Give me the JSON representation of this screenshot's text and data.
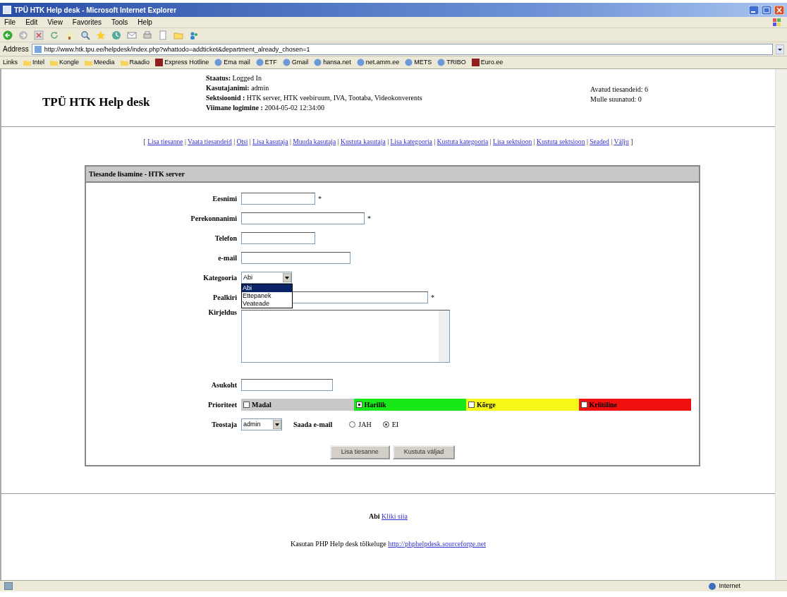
{
  "window": {
    "title": "TPÜ HTK Help desk - Microsoft Internet Explorer",
    "menu": [
      "File",
      "Edit",
      "View",
      "Favorites",
      "Tools",
      "Help"
    ],
    "address_label": "Address",
    "address": "http://www.htk.tpu.ee/helpdesk/index.php?whattodo=addticket&department_already_chosen=1",
    "links_label": "Links",
    "links": [
      {
        "label": "Intel",
        "kind": "folder"
      },
      {
        "label": "Kongle",
        "kind": "folder"
      },
      {
        "label": "Meedia",
        "kind": "folder"
      },
      {
        "label": "Raadio",
        "kind": "folder"
      },
      {
        "label": "Express Hotline",
        "kind": "site"
      },
      {
        "label": "Ema mail",
        "kind": "page"
      },
      {
        "label": "ETF",
        "kind": "page"
      },
      {
        "label": "Gmail",
        "kind": "page"
      },
      {
        "label": "hansa.net",
        "kind": "page"
      },
      {
        "label": "net.amm.ee",
        "kind": "page"
      },
      {
        "label": "METS",
        "kind": "page"
      },
      {
        "label": "TRIBO",
        "kind": "page"
      },
      {
        "label": "Euro.ee",
        "kind": "site"
      }
    ]
  },
  "header": {
    "logo": "TPÜ HTK Help desk",
    "status_lines": [
      {
        "label": "Staatus:",
        "value": "Logged In"
      },
      {
        "label": "Kasutajanimi:",
        "value": "admin"
      },
      {
        "label": "Sektsioonid :",
        "value": "HTK server, HTK veebiruum, IVA, Tootaba, Videokonverents"
      },
      {
        "label": "Viimane logimine :",
        "value": "2004-05-02 12:34:00"
      }
    ],
    "counters": [
      "Avatud tiesandeid: 6",
      "Mulle suunatud: 0"
    ]
  },
  "nav": [
    {
      "kind": "bracket",
      "text": "["
    },
    {
      "kind": "link",
      "text": "Lisa tiesanne"
    },
    {
      "kind": "separator",
      "text": "|"
    },
    {
      "kind": "link",
      "text": "Vaata tiesandeid"
    },
    {
      "kind": "separator",
      "text": "|"
    },
    {
      "kind": "link",
      "text": "Otsi"
    },
    {
      "kind": "separator",
      "text": "|"
    },
    {
      "kind": "link",
      "text": "Lisa kasutaja"
    },
    {
      "kind": "separator",
      "text": "|"
    },
    {
      "kind": "link",
      "text": "Muuda kasutaja"
    },
    {
      "kind": "separator",
      "text": "|"
    },
    {
      "kind": "link",
      "text": "Kustuta kasutaja"
    },
    {
      "kind": "separator",
      "text": "|"
    },
    {
      "kind": "link",
      "text": "Lisa kategooria"
    },
    {
      "kind": "separator",
      "text": "|"
    },
    {
      "kind": "link",
      "text": "Kustuta kategooria"
    },
    {
      "kind": "separator",
      "text": "|"
    },
    {
      "kind": "link",
      "text": "Lisa sektsioon"
    },
    {
      "kind": "separator",
      "text": "|"
    },
    {
      "kind": "link",
      "text": "Kustuta sektsioon"
    },
    {
      "kind": "separator",
      "text": "|"
    },
    {
      "kind": "link",
      "text": "Seaded"
    },
    {
      "kind": "separator",
      "text": "|"
    },
    {
      "kind": "link",
      "text": "Välju"
    },
    {
      "kind": "bracket",
      "text": "]"
    }
  ],
  "form": {
    "title": "Tiesande lisamine - HTK server",
    "rows": [
      {
        "kind": "text",
        "label": "Eesnimi",
        "required_mark": "*"
      },
      {
        "kind": "text",
        "label": "Perekonnanimi",
        "required_mark": "*"
      },
      {
        "kind": "text",
        "label": "Telefon"
      },
      {
        "kind": "text",
        "label": "e-mail"
      },
      {
        "kind": "select",
        "label": "Kategooria",
        "value": "Abi",
        "expanded": true,
        "options": [
          {
            "label": "Abi",
            "selected": true
          },
          {
            "label": "Ettepanek",
            "selected": false
          },
          {
            "label": "Veateade",
            "selected": false
          }
        ]
      },
      {
        "kind": "text",
        "label": "Pealkiri",
        "required_mark": "*"
      },
      {
        "kind": "textarea",
        "label": "Kirjeldus"
      },
      {
        "kind": "text",
        "label": "Asukoht"
      },
      {
        "kind": "priority",
        "label": "Prioriteet",
        "options": [
          {
            "label": "Madal",
            "color": "#c8c8c8",
            "selected": false
          },
          {
            "label": "Harilik",
            "color": "#18e818",
            "selected": true
          },
          {
            "label": "Kõrge",
            "color": "#f8f818",
            "selected": false
          },
          {
            "label": "Kriitiline",
            "color": "#f01010",
            "selected": false
          }
        ]
      },
      {
        "kind": "assignee",
        "label": "Teostaja",
        "value": "admin",
        "email_label": "Saada e-mail",
        "email_options": [
          {
            "label": "JAH",
            "selected": false
          },
          {
            "label": "EI",
            "selected": true
          }
        ]
      }
    ],
    "buttons": [
      "Lisa tiesanne",
      "Kustuta väljad"
    ]
  },
  "footer": {
    "help_label": "Abi",
    "help_link": "Kliki siia",
    "credit": "Kasutan PHP Help desk tõlkeluge",
    "credit_link": "http://phphelpdesk.sourceforge.net"
  },
  "status_bar": {
    "zone": "Internet"
  }
}
